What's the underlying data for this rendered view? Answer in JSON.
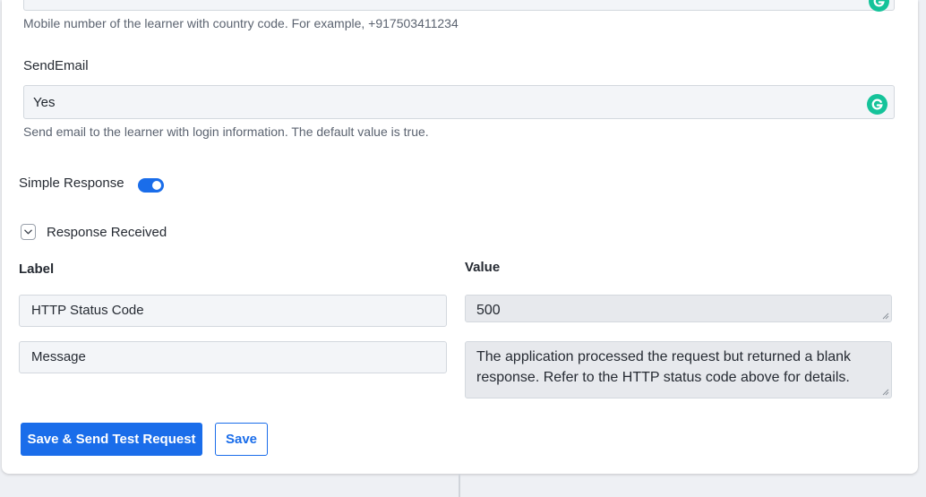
{
  "phone_field": {
    "help": "Mobile number of the learner with country code. For example, +917503411234"
  },
  "send_email": {
    "label": "SendEmail",
    "value": "Yes",
    "help": "Send email to the learner with login information. The default value is true."
  },
  "simple_response": {
    "label": "Simple Response",
    "enabled": true
  },
  "response_received": {
    "title": "Response Received",
    "expanded": true,
    "columns": {
      "label": "Label",
      "value": "Value"
    },
    "rows": [
      {
        "label": "HTTP Status Code",
        "value": "500"
      },
      {
        "label": "Message",
        "value": "The application processed the request but returned a blank response.  Refer to the HTTP status code above for details."
      }
    ]
  },
  "actions": {
    "save_send_label": "Save & Send Test Request",
    "save_label": "Save"
  },
  "colors": {
    "accent": "#1a6dea",
    "grammarly": "#15c39a"
  }
}
